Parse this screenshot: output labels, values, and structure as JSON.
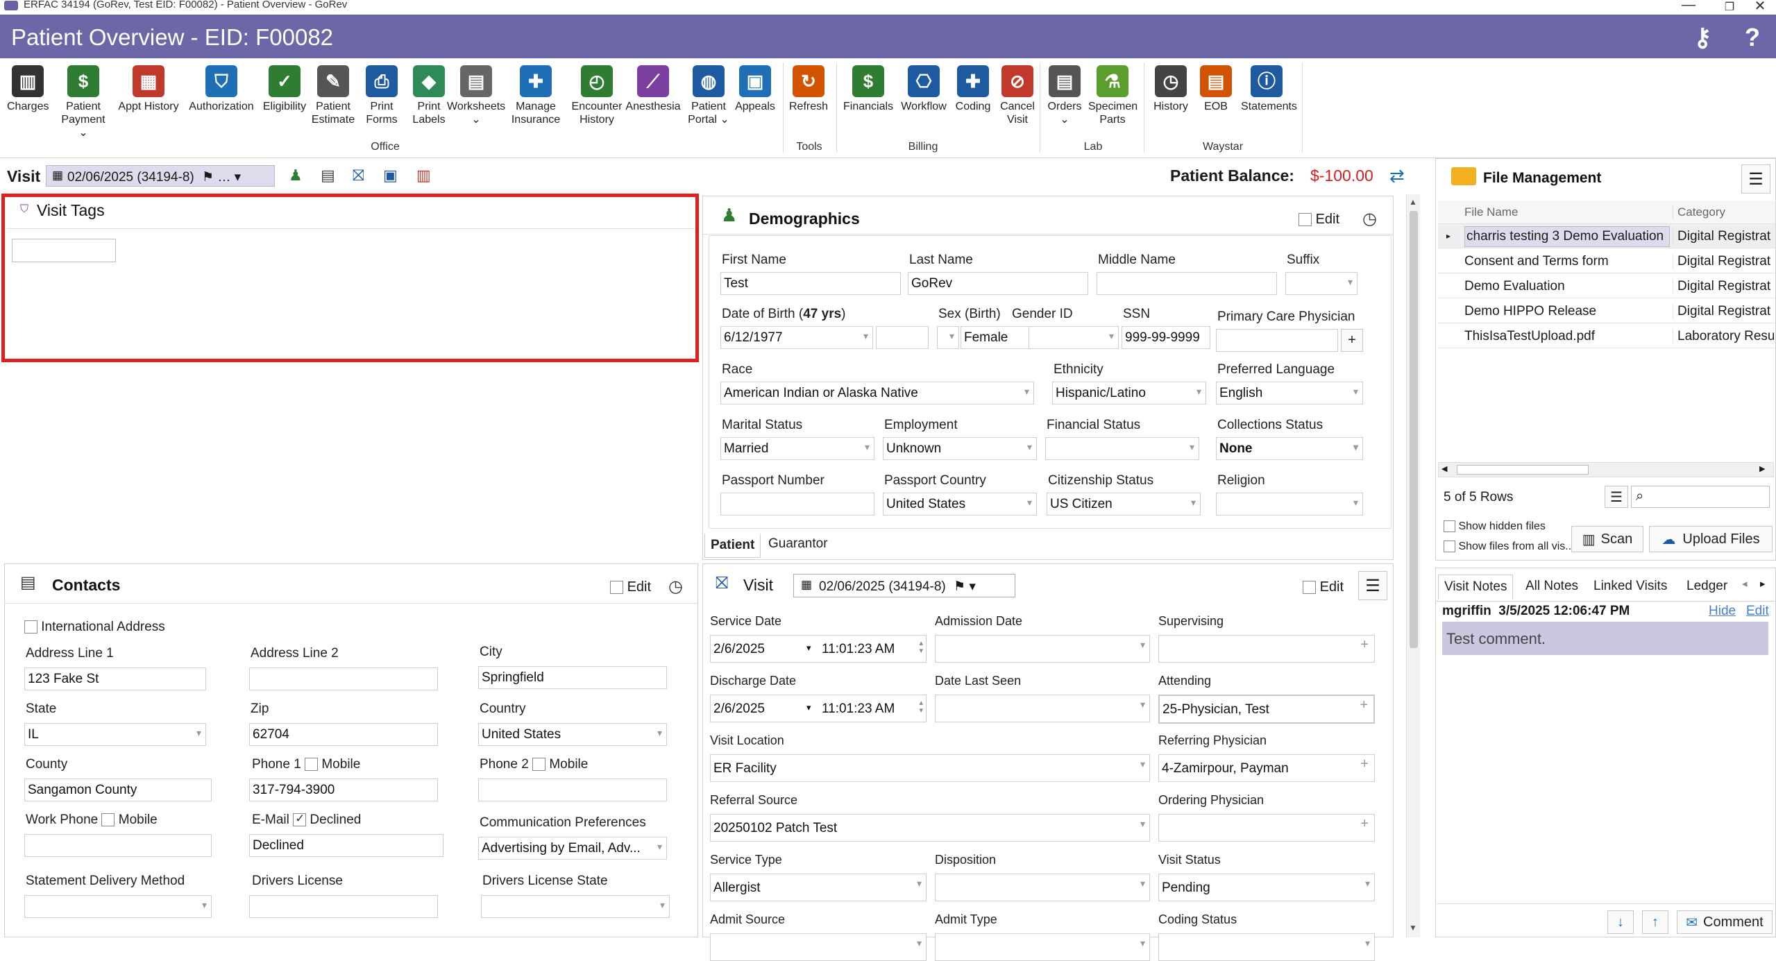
{
  "window": {
    "title": "ERFAC 34194 (GoRev, Test EID: F00082) - Patient Overview - GoRev",
    "minimize_icon": "minimize-icon",
    "maximize_icon": "maximize-icon",
    "close_icon": "close-icon"
  },
  "header": {
    "title": "Patient Overview - EID: F00082"
  },
  "ribbon": {
    "office": {
      "group_label": "Office",
      "buttons": [
        {
          "label": "Charges",
          "icon": "barcode-icon"
        },
        {
          "label": "Patient\nPayment ⌄",
          "icon": "payment-hand-icon"
        },
        {
          "label": "Appt History",
          "icon": "calendar-icon"
        },
        {
          "label": "Authorization",
          "icon": "shield-doc-icon"
        },
        {
          "label": "Eligibility",
          "icon": "person-check-icon"
        },
        {
          "label": "Patient\nEstimate",
          "icon": "estimate-icon"
        },
        {
          "label": "Print\nForms",
          "icon": "printer-icon"
        },
        {
          "label": "Print\nLabels",
          "icon": "label-tag-icon"
        },
        {
          "label": "Worksheets\n⌄",
          "icon": "worksheets-icon"
        },
        {
          "label": "Manage\nInsurance",
          "icon": "insurance-icon"
        },
        {
          "label": "Encounter\nHistory",
          "icon": "encounter-history-icon"
        },
        {
          "label": "Anesthesia",
          "icon": "syringe-icon"
        },
        {
          "label": "Patient\nPortal ⌄",
          "icon": "globe-gear-icon"
        },
        {
          "label": "Appeals",
          "icon": "appeals-icon"
        }
      ]
    },
    "tools": {
      "group_label": "Tools",
      "buttons": [
        {
          "label": "Refresh",
          "icon": "refresh-icon"
        }
      ]
    },
    "billing": {
      "group_label": "Billing",
      "buttons": [
        {
          "label": "Financials",
          "icon": "dollar-icon"
        },
        {
          "label": "Workflow",
          "icon": "workflow-icon"
        },
        {
          "label": "Coding",
          "icon": "coding-book-icon"
        },
        {
          "label": "Cancel\nVisit",
          "icon": "cancel-visit-icon"
        }
      ]
    },
    "lab": {
      "group_label": "Lab",
      "buttons": [
        {
          "label": "Orders\n⌄",
          "icon": "orders-icon"
        },
        {
          "label": "Specimen\nParts",
          "icon": "specimen-icon"
        }
      ]
    },
    "waystar": {
      "group_label": "Waystar",
      "buttons": [
        {
          "label": "History",
          "icon": "clock-icon"
        },
        {
          "label": "EOB",
          "icon": "eob-icon"
        },
        {
          "label": "Statements",
          "icon": "statements-icon"
        }
      ]
    }
  },
  "visitbar": {
    "label": "Visit",
    "selector": "02/06/2025 (34194-8)",
    "balance_label": "Patient Balance:",
    "balance_value": "$-100.00"
  },
  "visit_tags": {
    "title": "Visit Tags"
  },
  "demographics": {
    "title": "Demographics",
    "edit_label": "Edit",
    "fields": {
      "first_name_label": "First Name",
      "first_name": "Test",
      "last_name_label": "Last Name",
      "last_name": "GoRev",
      "middle_name_label": "Middle Name",
      "middle_name": "",
      "suffix_label": "Suffix",
      "suffix": "",
      "dob_label_prefix": "Date of Birth (",
      "dob_age": "47 yrs",
      "dob_label_suffix": ")",
      "dob": "6/12/1977",
      "sex_label": "Sex (Birth)",
      "sex": "",
      "gender_label": "Gender ID",
      "gender": "Female",
      "ssn_label": "SSN",
      "ssn": "999-99-9999",
      "pcp_label": "Primary Care Physician",
      "pcp": "",
      "race_label": "Race",
      "race": "American Indian or Alaska Native",
      "ethnicity_label": "Ethnicity",
      "ethnicity": "Hispanic/Latino",
      "language_label": "Preferred Language",
      "language": "English",
      "marital_label": "Marital Status",
      "marital": "Married",
      "employment_label": "Employment",
      "employment": "Unknown",
      "financial_label": "Financial Status",
      "financial": "",
      "collections_label": "Collections Status",
      "collections": "None",
      "passport_label": "Passport Number",
      "passport": "",
      "passport_country_label": "Passport Country",
      "passport_country": "United States",
      "citizenship_label": "Citizenship Status",
      "citizenship": "US Citizen",
      "religion_label": "Religion",
      "religion": ""
    },
    "tabs": [
      "Patient",
      "Guarantor"
    ]
  },
  "contacts": {
    "title": "Contacts",
    "edit_label": "Edit",
    "international_label": "International Address",
    "address1_label": "Address Line 1",
    "address1": "123 Fake St",
    "address2_label": "Address Line 2",
    "address2": "",
    "city_label": "City",
    "city": "Springfield",
    "state_label": "State",
    "state": "IL",
    "zip_label": "Zip",
    "zip": "62704",
    "country_label": "Country",
    "country": "United States",
    "county_label": "County",
    "county": "Sangamon County",
    "phone1_label": "Phone 1",
    "phone1": "317-794-3900",
    "phone2_label": "Phone 2",
    "phone2": "",
    "mobile_label": "Mobile",
    "work_phone_label": "Work Phone",
    "work_phone": "",
    "email_label": "E-Mail",
    "declined_label": "Declined",
    "email": "Declined",
    "comm_label": "Communication Preferences",
    "comm": "Advertising by Email, Adv...",
    "statement_label": "Statement Delivery Method",
    "statement": "",
    "dl_label": "Drivers License",
    "dl": "",
    "dl_state_label": "Drivers License State",
    "dl_state": ""
  },
  "visit": {
    "title": "Visit",
    "selector": "02/06/2025 (34194-8)",
    "edit_label": "Edit",
    "service_date_label": "Service Date",
    "service_date": "2/6/2025",
    "service_time": "11:01:23 AM",
    "admission_date_label": "Admission Date",
    "admission_date": "",
    "supervising_label": "Supervising",
    "supervising": "",
    "discharge_date_label": "Discharge Date",
    "discharge_date": "2/6/2025",
    "discharge_time": "11:01:23 AM",
    "last_seen_label": "Date Last Seen",
    "last_seen": "",
    "attending_label": "Attending",
    "attending": "25-Physician, Test",
    "location_label": "Visit Location",
    "location": "ER Facility",
    "referring_label": "Referring Physician",
    "referring": "4-Zamirpour, Payman",
    "referral_source_label": "Referral Source",
    "referral_source": "20250102 Patch Test",
    "ordering_label": "Ordering Physician",
    "ordering": "",
    "service_type_label": "Service Type",
    "service_type": "Allergist",
    "disposition_label": "Disposition",
    "disposition": "",
    "visit_status_label": "Visit Status",
    "visit_status": "Pending",
    "admit_source_label": "Admit Source",
    "admit_type_label": "Admit Type",
    "coding_status_label": "Coding Status"
  },
  "file_management": {
    "title": "File Management",
    "columns": [
      "File Name",
      "Category"
    ],
    "rows": [
      {
        "name": "charris testing 3 Demo Evaluation",
        "category": "Digital Registrat"
      },
      {
        "name": "Consent and Terms form",
        "category": "Digital Registrat"
      },
      {
        "name": "Demo Evaluation",
        "category": "Digital Registrat"
      },
      {
        "name": "Demo HIPPO Release",
        "category": "Digital Registrat"
      },
      {
        "name": "ThisIsaTestUpload.pdf",
        "category": "Laboratory Resu"
      }
    ],
    "row_count": "5 of 5 Rows",
    "show_hidden": "Show hidden files",
    "show_all": "Show files from all vis...",
    "scan_label": "Scan",
    "upload_label": "Upload Files"
  },
  "notes": {
    "tabs": [
      "Visit Notes",
      "All Notes",
      "Linked Visits",
      "Ledger"
    ],
    "author": "mgriffin",
    "timestamp": "3/5/2025 12:06:47 PM",
    "hide_label": "Hide",
    "edit_label": "Edit",
    "comment_text": "Test comment.",
    "comment_button": "Comment"
  },
  "colors": {
    "header": "#6c67a6",
    "balance": "#d62020",
    "highlight_border": "#e02020",
    "note_bg": "#c9c8e0"
  }
}
